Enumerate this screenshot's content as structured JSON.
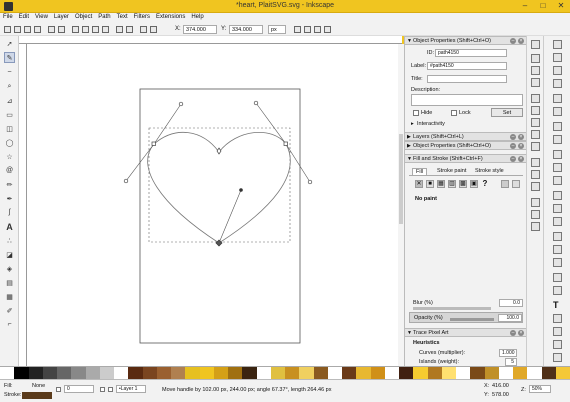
{
  "window": {
    "title": "*heart, PlaitSVG.svg - Inkscape",
    "minimize": "–",
    "maximize": "□",
    "close": "✕"
  },
  "menu": [
    "File",
    "Edit",
    "View",
    "Layer",
    "Object",
    "Path",
    "Text",
    "Filters",
    "Extensions",
    "Help"
  ],
  "controls": {
    "x_label": "X:",
    "x_value": "374.000",
    "y_label": "Y:",
    "y_value": "334.000",
    "unit": "px"
  },
  "toolbox": [
    "select-tool-icon",
    "node-tool-icon",
    "tweak-tool-icon",
    "zoom-tool-icon",
    "measure-tool-icon",
    "rect-tool-icon",
    "box3d-tool-icon",
    "ellipse-tool-icon",
    "star-tool-icon",
    "spiral-tool-icon",
    "pencil-tool-icon",
    "pen-tool-icon",
    "calligraphy-tool-icon",
    "text-tool-icon",
    "spray-tool-icon",
    "eraser-tool-icon",
    "bucket-tool-icon",
    "gradient-tool-icon",
    "mesh-tool-icon",
    "dropper-tool-icon",
    "connector-tool-icon"
  ],
  "object_properties": {
    "header": "Object Properties (Shift+Ctrl+O)",
    "id_label": "ID:",
    "id_value": "path4150",
    "label_label": "Label:",
    "label_value": "#path4150",
    "title_label": "Title:",
    "title_value": "",
    "description_label": "Description:",
    "hide_label": "Hide",
    "lock_label": "Lock",
    "set_label": "Set",
    "interactivity": "Interactivity"
  },
  "layers_header": "Layers (Shift+Ctrl+L)",
  "object_properties_collapsed": "Object Properties (Shift+Ctrl+O)",
  "fill_stroke": {
    "header": "Fill and Stroke (Shift+Ctrl+F)",
    "tabs": [
      "Fill",
      "Stroke paint",
      "Stroke style"
    ],
    "paint_buttons": [
      "✕",
      "■",
      "▦",
      "▥",
      "▩",
      "▣",
      "?"
    ],
    "no_paint": "No paint",
    "blur_label": "Blur (%)",
    "blur_value": "0.0",
    "opacity_label": "Opacity (%)",
    "opacity_value": "100.0"
  },
  "trace": {
    "header": "Trace Pixel Art",
    "heuristics": "Heuristics",
    "curves_label": "Curves (multiplier):",
    "curves_value": "1.000",
    "islands_label": "Islands (weight):",
    "islands_value": "5"
  },
  "status": {
    "fill_label": "Fill:",
    "fill_value": "None",
    "stroke_label": "Stroke:",
    "opacity": "0",
    "layer": "•Layer 1",
    "message": "Move handle by 102.00 px, 244.00 px; angle 67.37°, length 264.46 px",
    "x_label": "X:",
    "x_value": "416.00",
    "y_label": "Y:",
    "y_value": "578.00",
    "z_label": "Z:",
    "zoom": "50%"
  },
  "palette_colors": [
    "#ffffff",
    "#000000",
    "#222222",
    "#444444",
    "#666666",
    "#888888",
    "#aaaaaa",
    "#cccccc",
    "#ffffff",
    "#5a2a10",
    "#7a4520",
    "#9a6030",
    "#b08050",
    "#e6c020",
    "#f0c520",
    "#d4a017",
    "#a07010",
    "#3a2410",
    "#ffffff",
    "#e0c040",
    "#c89020",
    "#f0d060",
    "#8a5a20",
    "#ffffff",
    "#6a3a18",
    "#e8b830",
    "#d09018",
    "#ffffff",
    "#402010",
    "#f6cc30",
    "#b07820",
    "#ffe070",
    "#ffffff",
    "#7a4a18",
    "#c09028",
    "#ffffff",
    "#e0a828",
    "#ffffff",
    "#503018",
    "#f4c838"
  ]
}
